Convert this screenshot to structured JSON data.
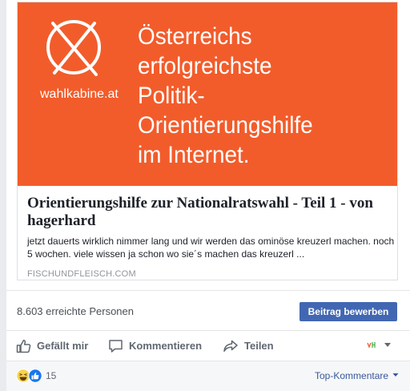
{
  "banner": {
    "logo_text": "wahlkabine.at",
    "headline_line1": "Österreichs erfolgreichste",
    "headline_line2": "Politik-Orientierungshilfe",
    "headline_line3": "im Internet."
  },
  "link": {
    "title": "Orientierungshilfe zur Nationalratswahl - Teil 1 - von hagerhard",
    "description": "jetzt dauerts wirklich nimmer lang und wir werden das ominöse kreuzerl machen. noch 5 wochen. viele wissen ja schon wo sie´s machen das kreuzerl ...",
    "domain": "FISCHUNDFLEISCH.COM"
  },
  "stats": {
    "reach": "8.603 erreichte Personen",
    "promote_label": "Beitrag bewerben"
  },
  "actions": {
    "like": "Gefällt mir",
    "comment": "Kommentieren",
    "share": "Teilen"
  },
  "footer": {
    "reaction_count": "15",
    "sort_label": "Top-Kommentare"
  },
  "colors": {
    "banner": "#f25c2b",
    "button": "#4267b2",
    "link": "#385898"
  }
}
